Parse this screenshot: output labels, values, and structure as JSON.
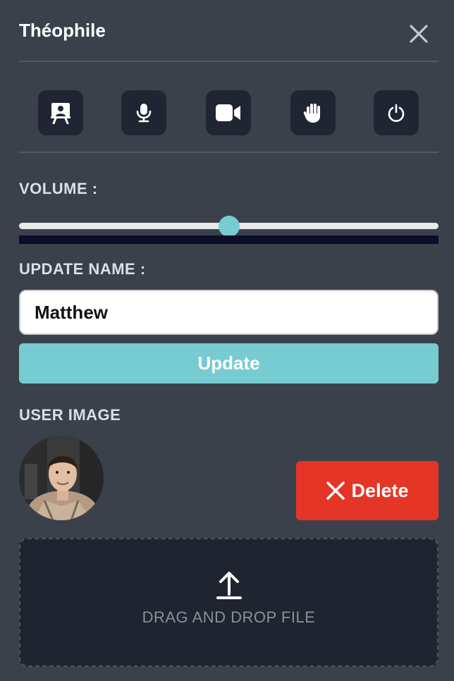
{
  "header": {
    "title": "Théophile",
    "close_icon": "close-icon"
  },
  "toolbar": {
    "items": [
      {
        "name": "presentation",
        "icon": "presenter-board-icon"
      },
      {
        "name": "microphone",
        "icon": "microphone-icon"
      },
      {
        "name": "camera",
        "icon": "video-camera-icon"
      },
      {
        "name": "raise-hand",
        "icon": "hand-icon"
      },
      {
        "name": "power",
        "icon": "power-icon"
      }
    ]
  },
  "volume": {
    "label": "VOLUME :",
    "value_fraction": 0.5
  },
  "update_name": {
    "label": "UPDATE NAME :",
    "value": "Matthew",
    "button_label": "Update"
  },
  "user_image": {
    "label": "USER IMAGE",
    "delete_label": "Delete"
  },
  "dropzone": {
    "icon": "upload-icon",
    "text": "DRAG AND DROP FILE"
  },
  "colors": {
    "background": "#3b414b",
    "accent": "#76ccd0",
    "danger": "#e53527",
    "tool_button": "#1f2532"
  }
}
